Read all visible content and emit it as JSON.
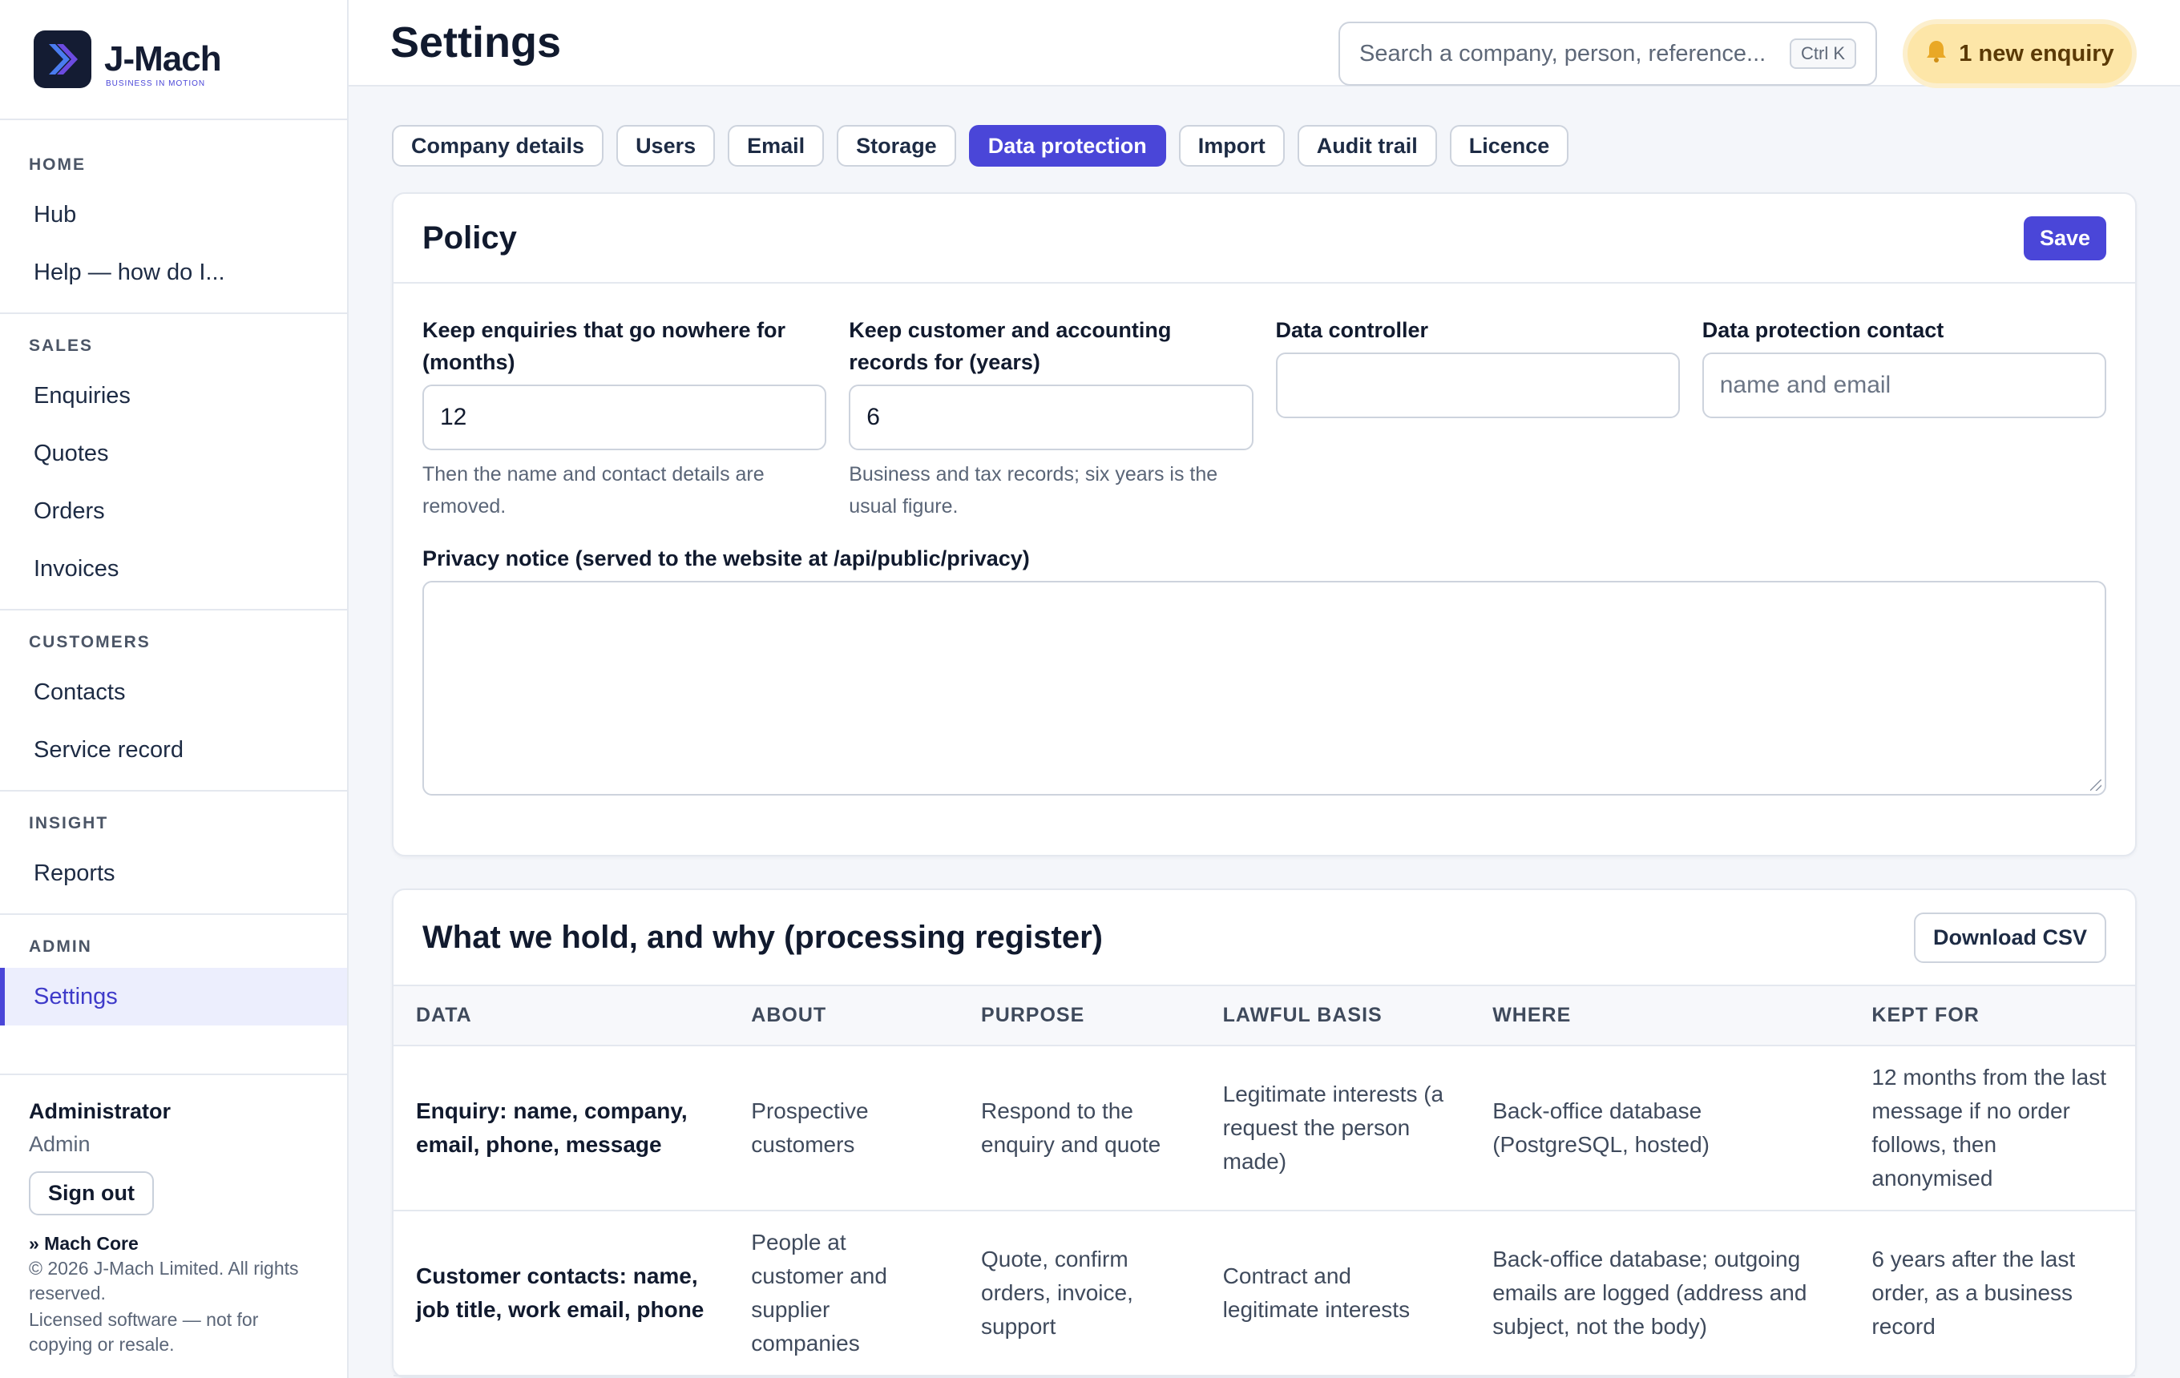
{
  "brand": {
    "name": "J-Mach",
    "tagline": "BUSINESS IN MOTION"
  },
  "sidebar": {
    "sections": [
      {
        "title": "HOME",
        "items": [
          "Hub",
          "Help — how do I..."
        ]
      },
      {
        "title": "SALES",
        "items": [
          "Enquiries",
          "Quotes",
          "Orders",
          "Invoices"
        ]
      },
      {
        "title": "CUSTOMERS",
        "items": [
          "Contacts",
          "Service record"
        ]
      },
      {
        "title": "INSIGHT",
        "items": [
          "Reports"
        ]
      },
      {
        "title": "ADMIN",
        "items": [
          "Settings"
        ]
      }
    ],
    "active_item": "Settings",
    "user": {
      "name": "Administrator",
      "role": "Admin",
      "signout": "Sign out"
    },
    "product": "» Mach Core",
    "legal_1": "© 2026 J-Mach Limited. All rights reserved.",
    "legal_2": "Licensed software — not for copying or resale."
  },
  "header": {
    "title": "Settings",
    "search_placeholder": "Search a company, person, reference...",
    "search_shortcut": "Ctrl K",
    "enquiry_badge": "1 new enquiry"
  },
  "tabs": [
    "Company details",
    "Users",
    "Email",
    "Storage",
    "Data protection",
    "Import",
    "Audit trail",
    "Licence"
  ],
  "active_tab": "Data protection",
  "policy": {
    "title": "Policy",
    "save_label": "Save",
    "fields": {
      "enquiries_label": "Keep enquiries that go nowhere for (months)",
      "enquiries_value": "12",
      "enquiries_hint": "Then the name and contact details are removed.",
      "records_label": "Keep customer and accounting records for (years)",
      "records_value": "6",
      "records_hint": "Business and tax records; six years is the usual figure.",
      "controller_label": "Data controller",
      "controller_value": "",
      "contact_label": "Data protection contact",
      "contact_placeholder": "name and email"
    },
    "notice_label": "Privacy notice (served to the website at /api/public/privacy)",
    "notice_value": ""
  },
  "register": {
    "title": "What we hold, and why (processing register)",
    "download_label": "Download CSV",
    "columns": [
      "DATA",
      "ABOUT",
      "PURPOSE",
      "LAWFUL BASIS",
      "WHERE",
      "KEPT FOR"
    ],
    "rows": [
      {
        "data": "Enquiry: name, company, email, phone, message",
        "about": "Prospective customers",
        "purpose": "Respond to the enquiry and quote",
        "basis": "Legitimate interests (a request the person made)",
        "where": "Back-office database (PostgreSQL, hosted)",
        "kept": "12 months from the last message if no order follows, then anonymised"
      },
      {
        "data": "Customer contacts: name, job title, work email, phone",
        "about": "People at customer and supplier companies",
        "purpose": "Quote, confirm orders, invoice, support",
        "basis": "Contract and legitimate interests",
        "where": "Back-office database; outgoing emails are logged (address and subject, not the body)",
        "kept": "6 years after the last order, as a business record"
      }
    ]
  },
  "colors": {
    "accent": "#4a46d8",
    "badge_bg": "#fde6a8",
    "badge_text": "#5b3a06"
  },
  "icons": {
    "logo": "chevron-logo-icon",
    "notification": "bell-icon"
  }
}
